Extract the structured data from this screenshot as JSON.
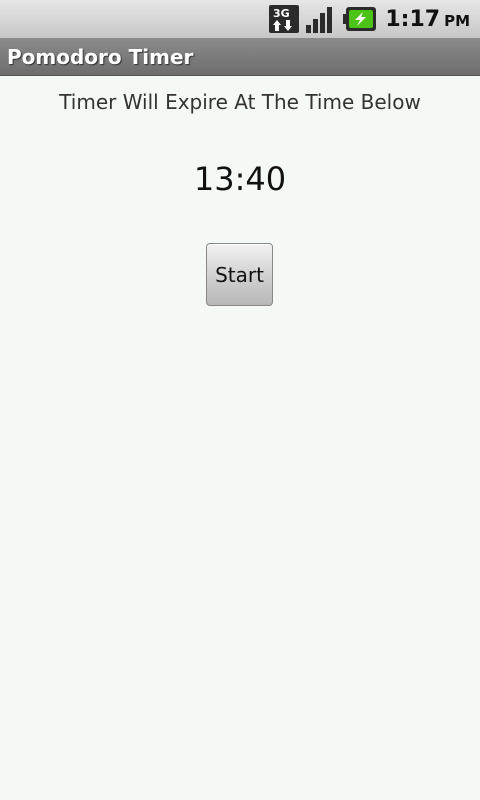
{
  "status_bar": {
    "network_icon": "3g-data-icon",
    "network_label": "3G",
    "signal_icon": "signal-strength-icon",
    "battery_icon": "battery-charging-icon",
    "time": "1:17",
    "ampm": "PM"
  },
  "app": {
    "title": "Pomodoro Timer"
  },
  "main": {
    "subtitle": "Timer Will Expire At The Time Below",
    "expire_time": "13:40",
    "start_label": "Start"
  }
}
